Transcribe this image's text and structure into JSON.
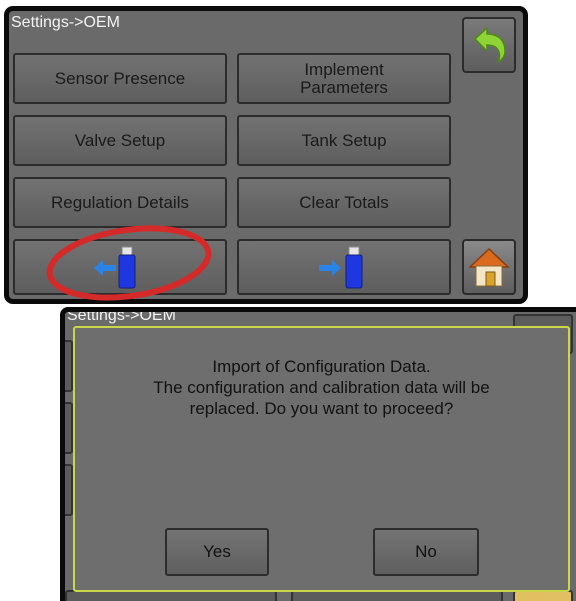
{
  "top_screen": {
    "title": "Settings->OEM",
    "buttons": {
      "sensor_presence": "Sensor Presence",
      "implement_parameters_line1": "Implement",
      "implement_parameters_line2": "Parameters",
      "valve_setup": "Valve Setup",
      "tank_setup": "Tank Setup",
      "regulation_details": "Regulation Details",
      "clear_totals": "Clear Totals"
    },
    "icons": {
      "back": "back-arrow-icon",
      "home": "home-icon",
      "import": "usb-import-icon",
      "export": "usb-export-icon"
    },
    "highlight_color": "#d42a2a"
  },
  "bottom_screen": {
    "title": "Settings->OEM",
    "dialog": {
      "line1": "Import of Configuration Data.",
      "line2": "The configuration and calibration data will be",
      "line3": "replaced. Do you want to proceed?",
      "yes_label": "Yes",
      "no_label": "No",
      "border_color": "#c7d84a"
    }
  },
  "colors": {
    "panel": "#6a6a6a",
    "usb_blue": "#1f37e0",
    "arrow_blue": "#2a84e8",
    "back_green": "#8fd436"
  }
}
